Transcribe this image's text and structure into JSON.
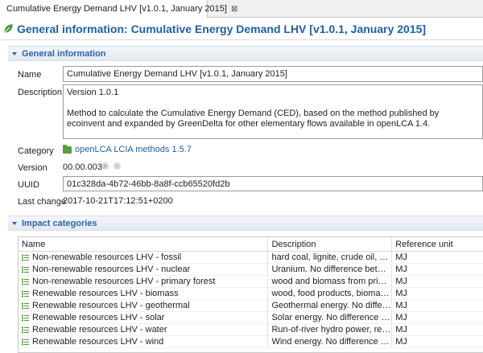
{
  "tab": {
    "title": "Cumulative Energy Demand LHV [v1.0.1, January 2015]",
    "close": "⊠"
  },
  "header": {
    "title": "General information: Cumulative Energy Demand LHV [v1.0.1, January 2015]"
  },
  "general_section": {
    "title": "General information"
  },
  "fields": {
    "name_label": "Name",
    "name_value": "Cumulative Energy Demand LHV [v1.0.1, January 2015]",
    "description_label": "Description",
    "description_value": "Version 1.0.1\n\nMethod to calculate the Cumulative Energy Demand (CED), based on the method published by ecoinvent and expanded by GreenDelta for other elementary flows available in openLCA 1.4.",
    "category_label": "Category",
    "category_value": "openLCA LCIA methods 1.5.7",
    "version_label": "Version",
    "version_value": "00.00.003",
    "version_up": "+",
    "version_down": "-",
    "uuid_label": "UUID",
    "uuid_value": "01c328da-4b72-46bb-8a8f-ccb65520fd2b",
    "last_change_label": "Last change",
    "last_change_value": "2017-10-21T17:12:51+0200"
  },
  "impact_section": {
    "title": "Impact categories"
  },
  "table": {
    "headers": [
      "Name",
      "Description",
      "Reference unit"
    ],
    "rows": [
      [
        "Non-renewable resources LHV - fossil",
        "hard coal, lignite, crude oil, natural gas, coal mining off-gas, peat",
        "MJ"
      ],
      [
        "Non-renewable resources LHV - nuclear",
        "Uranium. No difference between",
        "MJ"
      ],
      [
        "Non-renewable resources LHV - primary forest",
        "wood and biomass from primary forests",
        "MJ"
      ],
      [
        "Renewable resources LHV - biomass",
        "wood, food products, biomass from agriculture",
        "MJ"
      ],
      [
        "Renewable resources LHV - geothermal",
        "Geothermal energy. No difference between",
        "MJ"
      ],
      [
        "Renewable resources LHV - solar",
        "Solar energy. No difference between",
        "MJ"
      ],
      [
        "Renewable resources LHV - water",
        "Run-of-river hydro power, reservoir hydro power",
        "MJ"
      ],
      [
        "Renewable resources LHV - wind",
        "Wind energy. No difference between",
        "MJ"
      ]
    ]
  },
  "colors": {
    "accent": "#1f5fa8",
    "section": "#2a64b0",
    "category_folder": "#59a03a",
    "impact_icon": "#4a9a3a"
  },
  "icons": {
    "tab": "lcia-method-icon",
    "header": "lcia-method-icon",
    "category": "folder-icon",
    "row": "impact-category-icon"
  }
}
